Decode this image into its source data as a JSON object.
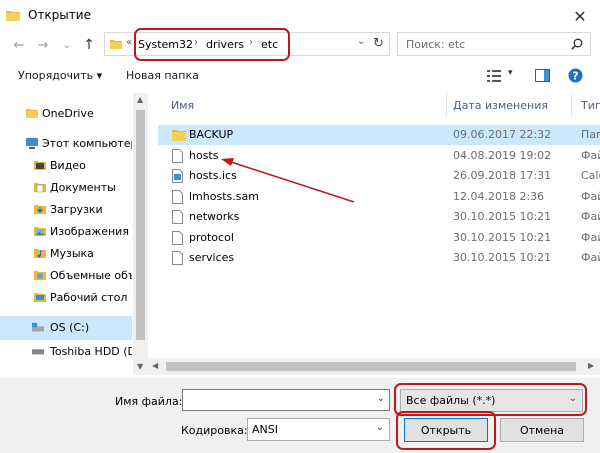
{
  "window": {
    "title": "Открытие",
    "close_glyph": "✕"
  },
  "nav": {
    "back_glyph": "←",
    "forward_glyph": "→",
    "recent_glyph": "⌄",
    "up_glyph": "↑",
    "overflow_glyph": "«",
    "breadcrumbs": [
      "System32",
      "drivers",
      "etc"
    ],
    "chevron_glyph": "›",
    "dropdown_glyph": "⌄",
    "refresh_glyph": "↻",
    "search_placeholder": "Поиск: etc"
  },
  "toolbar": {
    "organize_label": "Упорядочить ▾",
    "new_folder_label": "Новая папка"
  },
  "sidebar": {
    "items": [
      {
        "label": "OneDrive",
        "icon": "cloud-folder-icon"
      },
      {
        "label": "Этот компьютер",
        "icon": "computer-icon"
      },
      {
        "label": "Видео",
        "icon": "video-folder-icon"
      },
      {
        "label": "Документы",
        "icon": "documents-folder-icon"
      },
      {
        "label": "Загрузки",
        "icon": "downloads-folder-icon"
      },
      {
        "label": "Изображения",
        "icon": "pictures-folder-icon"
      },
      {
        "label": "Музыка",
        "icon": "music-folder-icon"
      },
      {
        "label": "Объемные объе",
        "icon": "3d-objects-folder-icon"
      },
      {
        "label": "Рабочий стол",
        "icon": "desktop-folder-icon"
      },
      {
        "label": "OS (C:)",
        "icon": "drive-icon"
      },
      {
        "label": "Toshiba HDD (D:",
        "icon": "drive-icon"
      }
    ]
  },
  "columns": {
    "name": "Имя",
    "date": "Дата изменения",
    "type": "Тип"
  },
  "files": [
    {
      "name": "BACKUP",
      "date": "09.06.2017 22:32",
      "type": "Пап",
      "kind": "folder"
    },
    {
      "name": "hosts",
      "date": "04.08.2019 19:02",
      "type": "Файл",
      "kind": "file"
    },
    {
      "name": "hosts.ics",
      "date": "26.09.2018 17:31",
      "type": "Cale",
      "kind": "calendar"
    },
    {
      "name": "lmhosts.sam",
      "date": "12.04.2018 2:36",
      "type": "Файл",
      "kind": "file"
    },
    {
      "name": "networks",
      "date": "30.10.2015 10:21",
      "type": "Файл",
      "kind": "file"
    },
    {
      "name": "protocol",
      "date": "30.10.2015 10:21",
      "type": "Файл",
      "kind": "file"
    },
    {
      "name": "services",
      "date": "30.10.2015 10:21",
      "type": "Файл",
      "kind": "file"
    }
  ],
  "bottom": {
    "filename_label": "Имя файла:",
    "filename_value": "",
    "filter_value": "Все файлы  (*.*)",
    "encoding_label": "Кодировка:",
    "encoding_value": "ANSI",
    "open_label": "Открыть",
    "cancel_label": "Отмена"
  },
  "colors": {
    "annotation": "#c01818",
    "selection": "#cce8ff",
    "folder": "#e8b93a"
  }
}
